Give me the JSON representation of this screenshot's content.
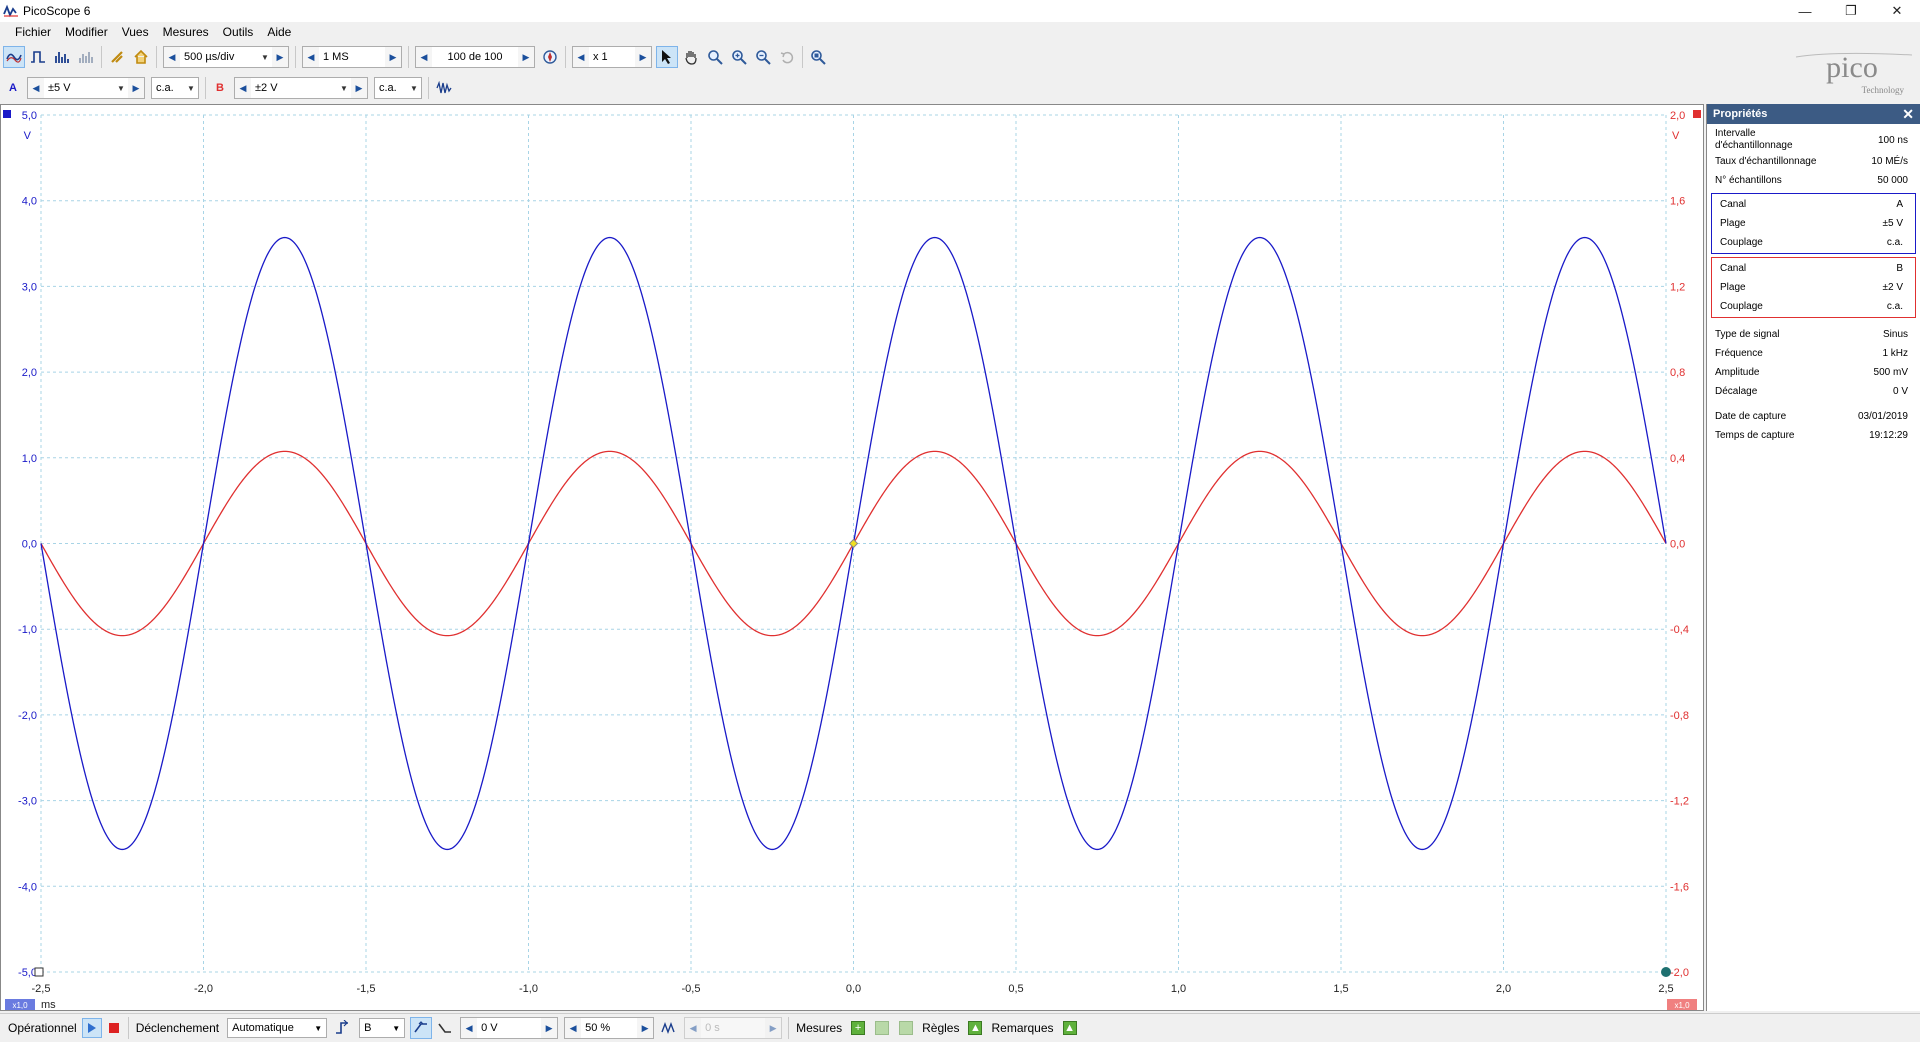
{
  "window": {
    "title": "PicoScope 6"
  },
  "menu": [
    "Fichier",
    "Modifier",
    "Vues",
    "Mesures",
    "Outils",
    "Aide"
  ],
  "toolbar": {
    "timebase": "500 µs/div",
    "samples": "1 MS",
    "buffer": "100 de 100",
    "zoom": "x 1"
  },
  "channels": {
    "a": {
      "label": "A",
      "range": "±5 V",
      "coupling": "c.a."
    },
    "b": {
      "label": "B",
      "range": "±2 V",
      "coupling": "c.a."
    }
  },
  "logo": {
    "name": "pico",
    "sub": "Technology"
  },
  "scope": {
    "x_ticks": [
      "-2,5",
      "-2,0",
      "-1,5",
      "-1,0",
      "-0,5",
      "0,0",
      "0,5",
      "1,0",
      "1,5",
      "2,0",
      "2,5"
    ],
    "x_unit": "ms",
    "left_ticks": [
      "5,0",
      "4,0",
      "3,0",
      "2,0",
      "1,0",
      "0,0",
      "-1,0",
      "-2,0",
      "-3,0",
      "-4,0",
      "-5,0"
    ],
    "left_unit": "V",
    "right_ticks": [
      "2,0",
      "1,6",
      "1,2",
      "0,8",
      "0,4",
      "0,0",
      "-0,4",
      "-0,8",
      "-1,2",
      "-1,6",
      "-2,0"
    ],
    "right_unit": "V",
    "zoom_badge_left": "x1,0",
    "zoom_badge_right": "x1,0",
    "colors": {
      "a": "#1a1ac8",
      "b": "#e03030",
      "grid": "#a8d4e6"
    }
  },
  "chart_data": {
    "type": "line",
    "xlabel": "ms",
    "ylabel": "V",
    "xlim": [
      -2.5,
      2.5
    ],
    "ylim_left": [
      -5,
      5
    ],
    "ylim_right": [
      -2,
      2
    ],
    "grid": true,
    "series": [
      {
        "axis": "left",
        "frequency_khz": 1,
        "amplitude": 3.57,
        "phase": "sine",
        "x_start": -2.5,
        "x_end": 2.5
      },
      {
        "axis": "right",
        "frequency_khz": 1,
        "amplitude": 0.43,
        "phase": "sine",
        "x_start": -2.5,
        "x_end": 2.5
      }
    ]
  },
  "properties": {
    "title": "Propriétés",
    "rows": [
      {
        "k": "Intervalle d'échantillonnage",
        "v": "100 ns"
      },
      {
        "k": "Taux d'échantillonnage",
        "v": "10 MÉ/s"
      },
      {
        "k": "N° échantillons",
        "v": "50 000"
      }
    ],
    "channel_a": [
      {
        "k": "Canal",
        "v": "A"
      },
      {
        "k": "Plage",
        "v": "±5 V"
      },
      {
        "k": "Couplage",
        "v": "c.a."
      }
    ],
    "channel_b": [
      {
        "k": "Canal",
        "v": "B"
      },
      {
        "k": "Plage",
        "v": "±2 V"
      },
      {
        "k": "Couplage",
        "v": "c.a."
      }
    ],
    "signal": [
      {
        "k": "Type de signal",
        "v": "Sinus"
      },
      {
        "k": "Fréquence",
        "v": "1 kHz"
      },
      {
        "k": "Amplitude",
        "v": "500 mV"
      },
      {
        "k": "Décalage",
        "v": "0 V"
      }
    ],
    "capture": [
      {
        "k": "Date de capture",
        "v": "03/01/2019"
      },
      {
        "k": "Temps de capture",
        "v": "19:12:29"
      }
    ]
  },
  "status": {
    "mode": "Opérationnel",
    "trigger_label": "Déclenchement",
    "trigger_mode": "Automatique",
    "trigger_channel": "B",
    "threshold": "0 V",
    "pretrigger": "50 %",
    "delay": "0 s",
    "measures": "Mesures",
    "rulers": "Règles",
    "notes": "Remarques"
  }
}
